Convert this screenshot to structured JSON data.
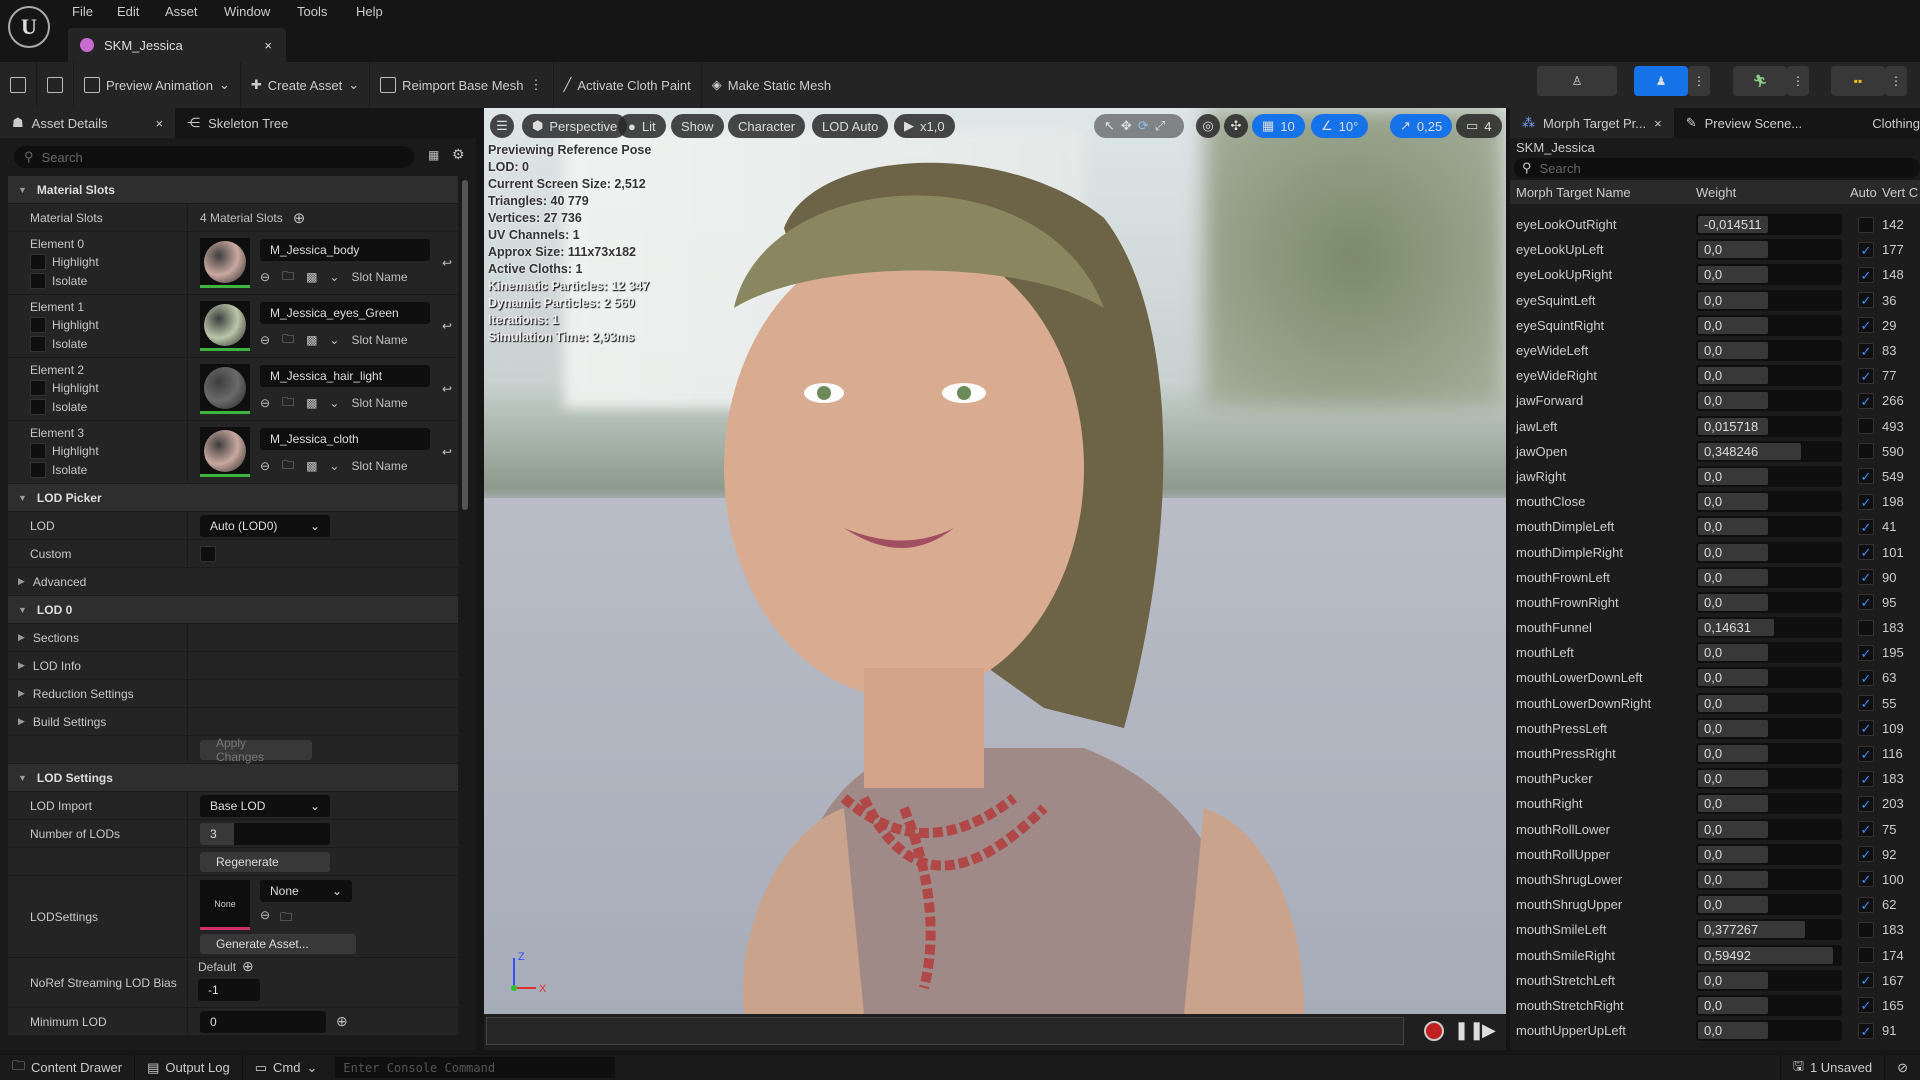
{
  "menu": [
    "File",
    "Edit",
    "Asset",
    "Window",
    "Tools",
    "Help"
  ],
  "doc_tab": {
    "title": "SKM_Jessica",
    "close": "×"
  },
  "toolbar": {
    "preview_animation": "Preview Animation",
    "create_asset": "Create Asset",
    "reimport": "Reimport Base Mesh",
    "cloth_paint": "Activate Cloth Paint",
    "make_static": "Make Static Mesh"
  },
  "left": {
    "tabs": [
      "Asset Details",
      "Skeleton Tree"
    ],
    "search_placeholder": "Search",
    "material_slots": {
      "header": "Material Slots",
      "label": "Material Slots",
      "count": "4 Material Slots",
      "elements": [
        {
          "label": "Element 0",
          "material": "M_Jessica_body",
          "color": "#c9a8a0"
        },
        {
          "label": "Element 1",
          "material": "M_Jessica_eyes_Green",
          "color": "#b9c6a8"
        },
        {
          "label": "Element 2",
          "material": "M_Jessica_hair_light",
          "color": "#6a6a6a"
        },
        {
          "label": "Element 3",
          "material": "M_Jessica_cloth",
          "color": "#c9a8a0"
        }
      ],
      "highlight": "Highlight",
      "isolate": "Isolate",
      "slot_name": "Slot Name"
    },
    "lod_picker": {
      "header": "LOD Picker",
      "lod_label": "LOD",
      "lod_value": "Auto (LOD0)",
      "custom_label": "Custom",
      "advanced": "Advanced"
    },
    "lod0": {
      "header": "LOD 0",
      "items": [
        "Sections",
        "LOD Info",
        "Reduction Settings",
        "Build Settings"
      ],
      "apply": "Apply Changes"
    },
    "lod_settings": {
      "header": "LOD Settings",
      "lod_import_label": "LOD Import",
      "lod_import": "Base LOD",
      "num_lods_label": "Number of LODs",
      "num_lods": "3",
      "regenerate": "Regenerate",
      "lodsettings_label": "LODSettings",
      "thumb_none": "None",
      "combo_none": "None",
      "generate": "Generate Asset...",
      "noref_label": "NoRef Streaming LOD Bias",
      "noref_default": "Default",
      "noref_value": "-1",
      "min_lod_label": "Minimum LOD",
      "min_lod": "0"
    }
  },
  "viewport": {
    "pills": {
      "perspective": "Perspective",
      "lit": "Lit",
      "show": "Show",
      "character": "Character",
      "lod": "LOD Auto",
      "speed": "x1,0",
      "grid": "10",
      "angle": "10°",
      "scale": "0,25",
      "camera": "4"
    },
    "stats": [
      "Previewing Reference Pose",
      "LOD: 0",
      "Current Screen Size: 2,512",
      "Triangles: 40 779",
      "Vertices: 27 736",
      "UV Channels: 1",
      "Approx Size: 111x73x182",
      "Active Cloths: 1",
      "Kinematic Particles: 12 347",
      "Dynamic Particles: 2 560",
      "Iterations: 1",
      "Simulation Time: 2,93ms"
    ],
    "axis": {
      "z": "Z",
      "x": "X"
    }
  },
  "right": {
    "tabs": [
      "Morph Target Pr...",
      "Preview Scene...",
      "Clothing"
    ],
    "asset": "SKM_Jessica",
    "search_placeholder": "Search",
    "columns": [
      "Morph Target Name",
      "Weight",
      "Auto",
      "Vert C"
    ],
    "rows": [
      {
        "name": "eyeLookOutRight",
        "weight": "-0,014511",
        "w": -0.014511,
        "auto": false,
        "verts": "142"
      },
      {
        "name": "eyeLookUpLeft",
        "weight": "0,0",
        "w": 0,
        "auto": true,
        "verts": "177"
      },
      {
        "name": "eyeLookUpRight",
        "weight": "0,0",
        "w": 0,
        "auto": true,
        "verts": "148"
      },
      {
        "name": "eyeSquintLeft",
        "weight": "0,0",
        "w": 0,
        "auto": true,
        "verts": "36"
      },
      {
        "name": "eyeSquintRight",
        "weight": "0,0",
        "w": 0,
        "auto": true,
        "verts": "29"
      },
      {
        "name": "eyeWideLeft",
        "weight": "0,0",
        "w": 0,
        "auto": true,
        "verts": "83"
      },
      {
        "name": "eyeWideRight",
        "weight": "0,0",
        "w": 0,
        "auto": true,
        "verts": "77"
      },
      {
        "name": "jawForward",
        "weight": "0,0",
        "w": 0,
        "auto": true,
        "verts": "266"
      },
      {
        "name": "jawLeft",
        "weight": "0,015718",
        "w": 0.015718,
        "auto": false,
        "verts": "493"
      },
      {
        "name": "jawOpen",
        "weight": "0,348246",
        "w": 0.348246,
        "auto": false,
        "verts": "590"
      },
      {
        "name": "jawRight",
        "weight": "0,0",
        "w": 0,
        "auto": true,
        "verts": "549"
      },
      {
        "name": "mouthClose",
        "weight": "0,0",
        "w": 0,
        "auto": true,
        "verts": "198"
      },
      {
        "name": "mouthDimpleLeft",
        "weight": "0,0",
        "w": 0,
        "auto": true,
        "verts": "41"
      },
      {
        "name": "mouthDimpleRight",
        "weight": "0,0",
        "w": 0,
        "auto": true,
        "verts": "101"
      },
      {
        "name": "mouthFrownLeft",
        "weight": "0,0",
        "w": 0,
        "auto": true,
        "verts": "90"
      },
      {
        "name": "mouthFrownRight",
        "weight": "0,0",
        "w": 0,
        "auto": true,
        "verts": "95"
      },
      {
        "name": "mouthFunnel",
        "weight": "0,14631",
        "w": 0.14631,
        "auto": false,
        "verts": "183"
      },
      {
        "name": "mouthLeft",
        "weight": "0,0",
        "w": 0,
        "auto": true,
        "verts": "195"
      },
      {
        "name": "mouthLowerDownLeft",
        "weight": "0,0",
        "w": 0,
        "auto": true,
        "verts": "63"
      },
      {
        "name": "mouthLowerDownRight",
        "weight": "0,0",
        "w": 0,
        "auto": true,
        "verts": "55"
      },
      {
        "name": "mouthPressLeft",
        "weight": "0,0",
        "w": 0,
        "auto": true,
        "verts": "109"
      },
      {
        "name": "mouthPressRight",
        "weight": "0,0",
        "w": 0,
        "auto": true,
        "verts": "116"
      },
      {
        "name": "mouthPucker",
        "weight": "0,0",
        "w": 0,
        "auto": true,
        "verts": "183"
      },
      {
        "name": "mouthRight",
        "weight": "0,0",
        "w": 0,
        "auto": true,
        "verts": "203"
      },
      {
        "name": "mouthRollLower",
        "weight": "0,0",
        "w": 0,
        "auto": true,
        "verts": "75"
      },
      {
        "name": "mouthRollUpper",
        "weight": "0,0",
        "w": 0,
        "auto": true,
        "verts": "92"
      },
      {
        "name": "mouthShrugLower",
        "weight": "0,0",
        "w": 0,
        "auto": true,
        "verts": "100"
      },
      {
        "name": "mouthShrugUpper",
        "weight": "0,0",
        "w": 0,
        "auto": true,
        "verts": "62"
      },
      {
        "name": "mouthSmileLeft",
        "weight": "0,377267",
        "w": 0.377267,
        "auto": false,
        "verts": "183"
      },
      {
        "name": "mouthSmileRight",
        "weight": "0,59492",
        "w": 0.59492,
        "auto": false,
        "verts": "174"
      },
      {
        "name": "mouthStretchLeft",
        "weight": "0,0",
        "w": 0,
        "auto": true,
        "verts": "167"
      },
      {
        "name": "mouthStretchRight",
        "weight": "0,0",
        "w": 0,
        "auto": true,
        "verts": "165"
      },
      {
        "name": "mouthUpperUpLeft",
        "weight": "0,0",
        "w": 0,
        "auto": true,
        "verts": "91"
      }
    ]
  },
  "status": {
    "content_drawer": "Content Drawer",
    "output_log": "Output Log",
    "cmd": "Cmd",
    "console_placeholder": "Enter Console Command",
    "unsaved": "1 Unsaved"
  },
  "colors": {
    "accent": "#1672e8",
    "checkbox": "#3b8fff",
    "thumb_ok": "#3fb53f"
  }
}
